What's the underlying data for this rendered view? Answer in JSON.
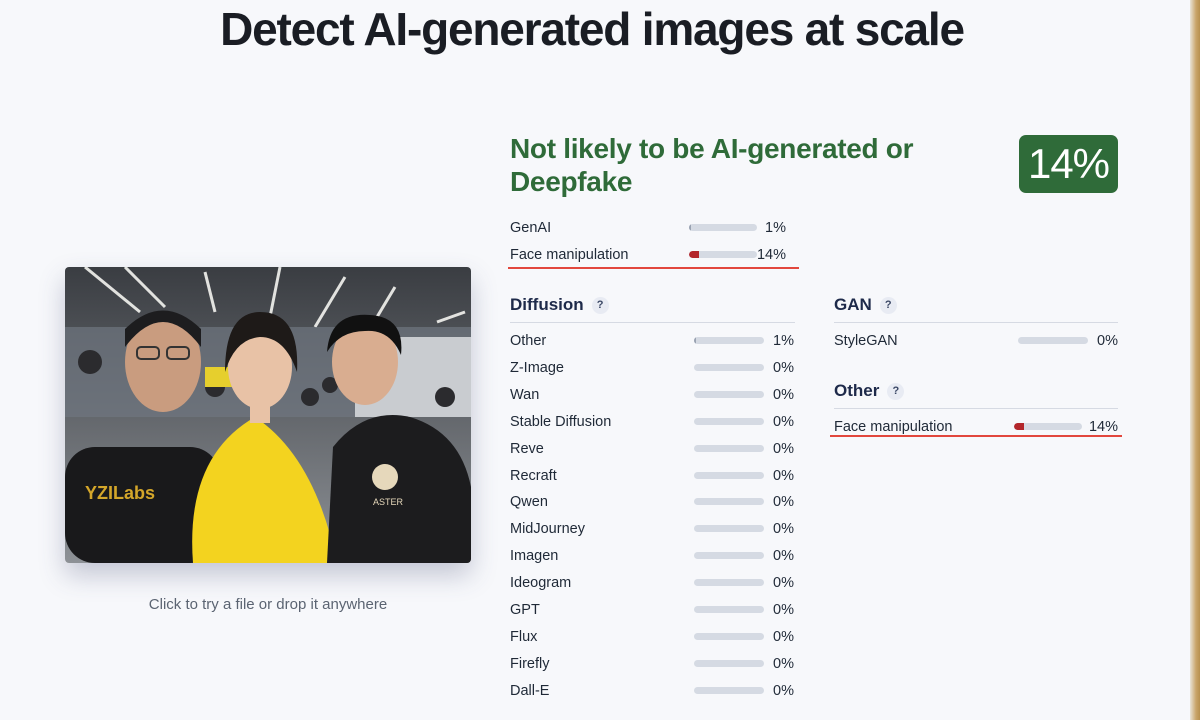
{
  "headline": "Detect AI-generated images at scale",
  "upload": {
    "hint": "Click to try a file or drop it anywhere"
  },
  "verdict": {
    "text": "Not likely to be AI-generated or Deepfake",
    "score": "14%",
    "color": "#2f6b39"
  },
  "summary": [
    {
      "label": "GenAI",
      "pct": "1%",
      "value": 0.01
    },
    {
      "label": "Face manipulation",
      "pct": "14%",
      "value": 0.14
    }
  ],
  "diffusion": {
    "title": "Diffusion",
    "help": "?",
    "items": [
      {
        "label": "Other",
        "pct": "1%",
        "value": 0.01
      },
      {
        "label": "Z-Image",
        "pct": "0%",
        "value": 0
      },
      {
        "label": "Wan",
        "pct": "0%",
        "value": 0
      },
      {
        "label": "Stable Diffusion",
        "pct": "0%",
        "value": 0
      },
      {
        "label": "Reve",
        "pct": "0%",
        "value": 0
      },
      {
        "label": "Recraft",
        "pct": "0%",
        "value": 0
      },
      {
        "label": "Qwen",
        "pct": "0%",
        "value": 0
      },
      {
        "label": "MidJourney",
        "pct": "0%",
        "value": 0
      },
      {
        "label": "Imagen",
        "pct": "0%",
        "value": 0
      },
      {
        "label": "Ideogram",
        "pct": "0%",
        "value": 0
      },
      {
        "label": "GPT",
        "pct": "0%",
        "value": 0
      },
      {
        "label": "Flux",
        "pct": "0%",
        "value": 0
      },
      {
        "label": "Firefly",
        "pct": "0%",
        "value": 0
      },
      {
        "label": "Dall-E",
        "pct": "0%",
        "value": 0
      }
    ]
  },
  "gan": {
    "title": "GAN",
    "help": "?",
    "items": [
      {
        "label": "StyleGAN",
        "pct": "0%",
        "value": 0
      }
    ]
  },
  "other": {
    "title": "Other",
    "help": "?",
    "items": [
      {
        "label": "Face manipulation",
        "pct": "14%",
        "value": 0.14
      }
    ]
  },
  "photo": {
    "shirt_left": "YZILabs",
    "shirt_right": "ASTER"
  },
  "colors": {
    "bar_fill": "#b3262b",
    "bar_track": "#d5dae3",
    "highlight_line": "#e2473d"
  }
}
